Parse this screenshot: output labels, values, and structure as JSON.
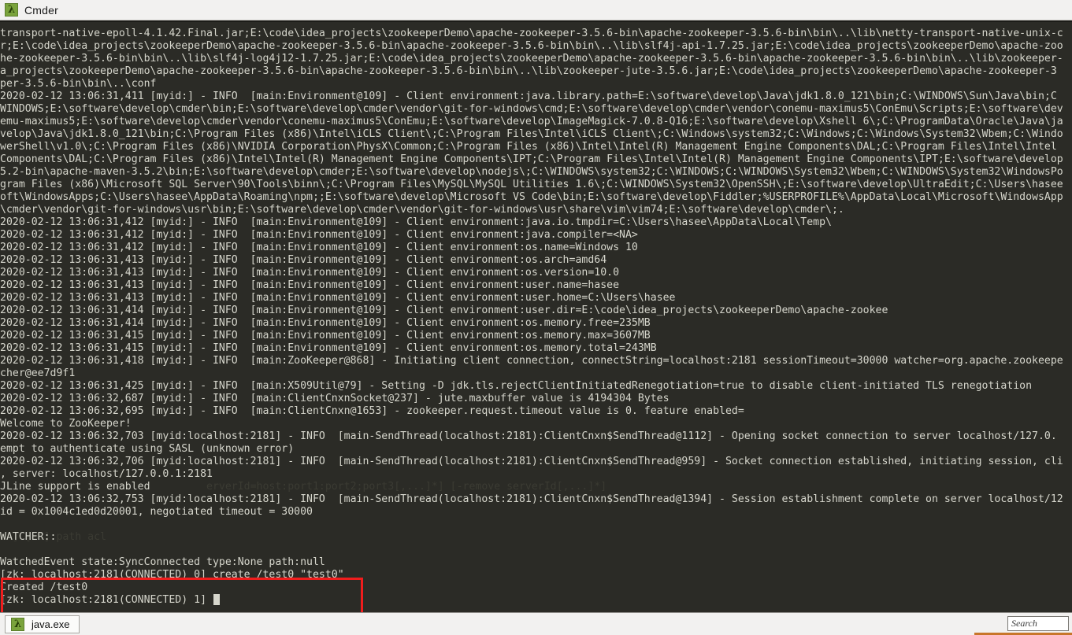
{
  "window": {
    "title": "Cmder",
    "icon": "lambda-icon",
    "icon_glyph": "λ"
  },
  "status_bar": {
    "tabs": [
      {
        "label": "java.exe",
        "icon": "lambda-icon",
        "icon_glyph": "λ",
        "active": true
      }
    ],
    "search": {
      "placeholder": "Search",
      "value": ""
    }
  },
  "annotation": {
    "type": "red-rectangle",
    "color": "#f01d1d",
    "covers_lines": [
      "WatchedEvent state:SyncConnected type:None path:null",
      "[zk: localhost:2181(CONNECTED) 0] create /test0 \"test0\"",
      "Created /test0"
    ]
  },
  "colors": {
    "terminal_background": "#2b2b26",
    "terminal_foreground": "#d6d6cc",
    "chrome_background": "#f2f1f0",
    "highlight": "#f01d1d",
    "accent_green": "#7aa33c"
  },
  "terminal": {
    "prompt": "[zk: localhost:2181(CONNECTED) 1] ",
    "cursor_visible": true,
    "lines": [
      {
        "text": "transport-native-epoll-4.1.42.Final.jar;E:\\code\\idea_projects\\zookeeperDemo\\apache-zookeeper-3.5.6-bin\\apache-zookeeper-3.5.6-bin\\bin\\..\\lib\\netty-transport-native-unix-c"
      },
      {
        "text": "r;E:\\code\\idea_projects\\zookeeperDemo\\apache-zookeeper-3.5.6-bin\\apache-zookeeper-3.5.6-bin\\bin\\..\\lib\\slf4j-api-1.7.25.jar;E:\\code\\idea_projects\\zookeeperDemo\\apache-zoo"
      },
      {
        "text": "he-zookeeper-3.5.6-bin\\bin\\..\\lib\\slf4j-log4j12-1.7.25.jar;E:\\code\\idea_projects\\zookeeperDemo\\apache-zookeeper-3.5.6-bin\\apache-zookeeper-3.5.6-bin\\bin\\..\\lib\\zookeeper-"
      },
      {
        "text": "a_projects\\zookeeperDemo\\apache-zookeeper-3.5.6-bin\\apache-zookeeper-3.5.6-bin\\bin\\..\\lib\\zookeeper-jute-3.5.6.jar;E:\\code\\idea_projects\\zookeeperDemo\\apache-zookeeper-3"
      },
      {
        "text": "per-3.5.6-bin\\bin\\..\\conf"
      },
      {
        "text": "2020-02-12 13:06:31,411 [myid:] - INFO  [main:Environment@109] - Client environment:java.library.path=E:\\software\\develop\\Java\\jdk1.8.0_121\\bin;C:\\WINDOWS\\Sun\\Java\\bin;C"
      },
      {
        "text": "WINDOWS;E:\\software\\develop\\cmder\\bin;E:\\software\\develop\\cmder\\vendor\\git-for-windows\\cmd;E:\\software\\develop\\cmder\\vendor\\conemu-maximus5\\ConEmu\\Scripts;E:\\software\\dev"
      },
      {
        "text": "emu-maximus5;E:\\software\\develop\\cmder\\vendor\\conemu-maximus5\\ConEmu;E:\\software\\develop\\ImageMagick-7.0.8-Q16;E:\\software\\develop\\Xshell 6\\;C:\\ProgramData\\Oracle\\Java\\ja"
      },
      {
        "text": "velop\\Java\\jdk1.8.0_121\\bin;C:\\Program Files (x86)\\Intel\\iCLS Client\\;C:\\Program Files\\Intel\\iCLS Client\\;C:\\Windows\\system32;C:\\Windows;C:\\Windows\\System32\\Wbem;C:\\Windo"
      },
      {
        "text": "werShell\\v1.0\\;C:\\Program Files (x86)\\NVIDIA Corporation\\PhysX\\Common;C:\\Program Files (x86)\\Intel\\Intel(R) Management Engine Components\\DAL;C:\\Program Files\\Intel\\Intel"
      },
      {
        "text": "Components\\DAL;C:\\Program Files (x86)\\Intel\\Intel(R) Management Engine Components\\IPT;C:\\Program Files\\Intel\\Intel(R) Management Engine Components\\IPT;E:\\software\\develop"
      },
      {
        "text": "5.2-bin\\apache-maven-3.5.2\\bin;E:\\software\\develop\\cmder;E:\\software\\develop\\nodejs\\;C:\\WINDOWS\\system32;C:\\WINDOWS;C:\\WINDOWS\\System32\\Wbem;C:\\WINDOWS\\System32\\WindowsPo"
      },
      {
        "text": "gram Files (x86)\\Microsoft SQL Server\\90\\Tools\\binn\\;C:\\Program Files\\MySQL\\MySQL Utilities 1.6\\;C:\\WINDOWS\\System32\\OpenSSH\\;E:\\software\\develop\\UltraEdit;C:\\Users\\hasee"
      },
      {
        "text": "oft\\WindowsApps;C:\\Users\\hasee\\AppData\\Roaming\\npm;;E:\\software\\develop\\Microsoft VS Code\\bin;E:\\software\\develop\\Fiddler;%USERPROFILE%\\AppData\\Local\\Microsoft\\WindowsApp"
      },
      {
        "text": "\\cmder\\vendor\\git-for-windows\\usr\\bin;E:\\software\\develop\\cmder\\vendor\\git-for-windows\\usr\\share\\vim\\vim74;E:\\software\\develop\\cmder\\;."
      },
      {
        "text": "2020-02-12 13:06:31,412 [myid:] - INFO  [main:Environment@109] - Client environment:java.io.tmpdir=C:\\Users\\hasee\\AppData\\Local\\Temp\\"
      },
      {
        "text": "2020-02-12 13:06:31,412 [myid:] - INFO  [main:Environment@109] - Client environment:java.compiler=<NA>"
      },
      {
        "text": "2020-02-12 13:06:31,412 [myid:] - INFO  [main:Environment@109] - Client environment:os.name=Windows 10"
      },
      {
        "text": "2020-02-12 13:06:31,413 [myid:] - INFO  [main:Environment@109] - Client environment:os.arch=amd64"
      },
      {
        "text": "2020-02-12 13:06:31,413 [myid:] - INFO  [main:Environment@109] - Client environment:os.version=10.0"
      },
      {
        "text": "2020-02-12 13:06:31,413 [myid:] - INFO  [main:Environment@109] - Client environment:user.name=hasee"
      },
      {
        "text": "2020-02-12 13:06:31,413 [myid:] - INFO  [main:Environment@109] - Client environment:user.home=C:\\Users\\hasee"
      },
      {
        "text": "2020-02-12 13:06:31,414 [myid:] - INFO  [main:Environment@109] - Client environment:user.dir=E:\\code\\idea_projects\\zookeeperDemo\\apache-zookee"
      },
      {
        "text": "2020-02-12 13:06:31,414 [myid:] - INFO  [main:Environment@109] - Client environment:os.memory.free=235MB"
      },
      {
        "text": "2020-02-12 13:06:31,415 [myid:] - INFO  [main:Environment@109] - Client environment:os.memory.max=3607MB"
      },
      {
        "text": "2020-02-12 13:06:31,415 [myid:] - INFO  [main:Environment@109] - Client environment:os.memory.total=243MB"
      },
      {
        "text": "2020-02-12 13:06:31,418 [myid:] - INFO  [main:ZooKeeper@868] - Initiating client connection, connectString=localhost:2181 sessionTimeout=30000 watcher=org.apache.zookeepe"
      },
      {
        "text": "cher@ee7d9f1"
      },
      {
        "text": "2020-02-12 13:06:31,425 [myid:] - INFO  [main:X509Util@79] - Setting -D jdk.tls.rejectClientInitiatedRenegotiation=true to disable client-initiated TLS renegotiation"
      },
      {
        "text": "2020-02-12 13:06:32,687 [myid:] - INFO  [main:ClientCnxnSocket@237] - jute.maxbuffer value is 4194304 Bytes"
      },
      {
        "text": "2020-02-12 13:06:32,695 [myid:] - INFO  [main:ClientCnxn@1653] - zookeeper.request.timeout value is 0. feature enabled="
      },
      {
        "text": "Welcome to ZooKeeper!"
      },
      {
        "text": "2020-02-12 13:06:32,703 [myid:localhost:2181] - INFO  [main-SendThread(localhost:2181):ClientCnxn$SendThread@1112] - Opening socket connection to server localhost/127.0."
      },
      {
        "text": "empt to authenticate using SASL (unknown error)"
      },
      {
        "text": "2020-02-12 13:06:32,706 [myid:localhost:2181] - INFO  [main-SendThread(localhost:2181):ClientCnxn$SendThread@959] - Socket connection established, initiating session, cli"
      },
      {
        "text": ", server: localhost/127.0.0.1:2181"
      },
      {
        "text": "JLine support is enabled",
        "ghost_overlay": "                                 erverId=host:port1:port2;port3[,...]*] [-remove serverId[,...]*]"
      },
      {
        "text": "2020-02-12 13:06:32,753 [myid:localhost:2181] - INFO  [main-SendThread(localhost:2181):ClientCnxn$SendThread@1394] - Session establishment complete on server localhost/12"
      },
      {
        "text": "id = 0x1004c1ed0d20001, negotiated timeout = 30000"
      },
      {
        "text": ""
      },
      {
        "text": "WATCHER::",
        "ghost_overlay": "on] [-s] path acl"
      },
      {
        "text": ""
      },
      {
        "text": "WatchedEvent state:SyncConnected type:None path:null"
      },
      {
        "text": "[zk: localhost:2181(CONNECTED) 0] create /test0 \"test0\""
      },
      {
        "text": "Created /test0"
      },
      {
        "text": "[zk: localhost:2181(CONNECTED) 1] ",
        "cursor": true
      }
    ]
  }
}
